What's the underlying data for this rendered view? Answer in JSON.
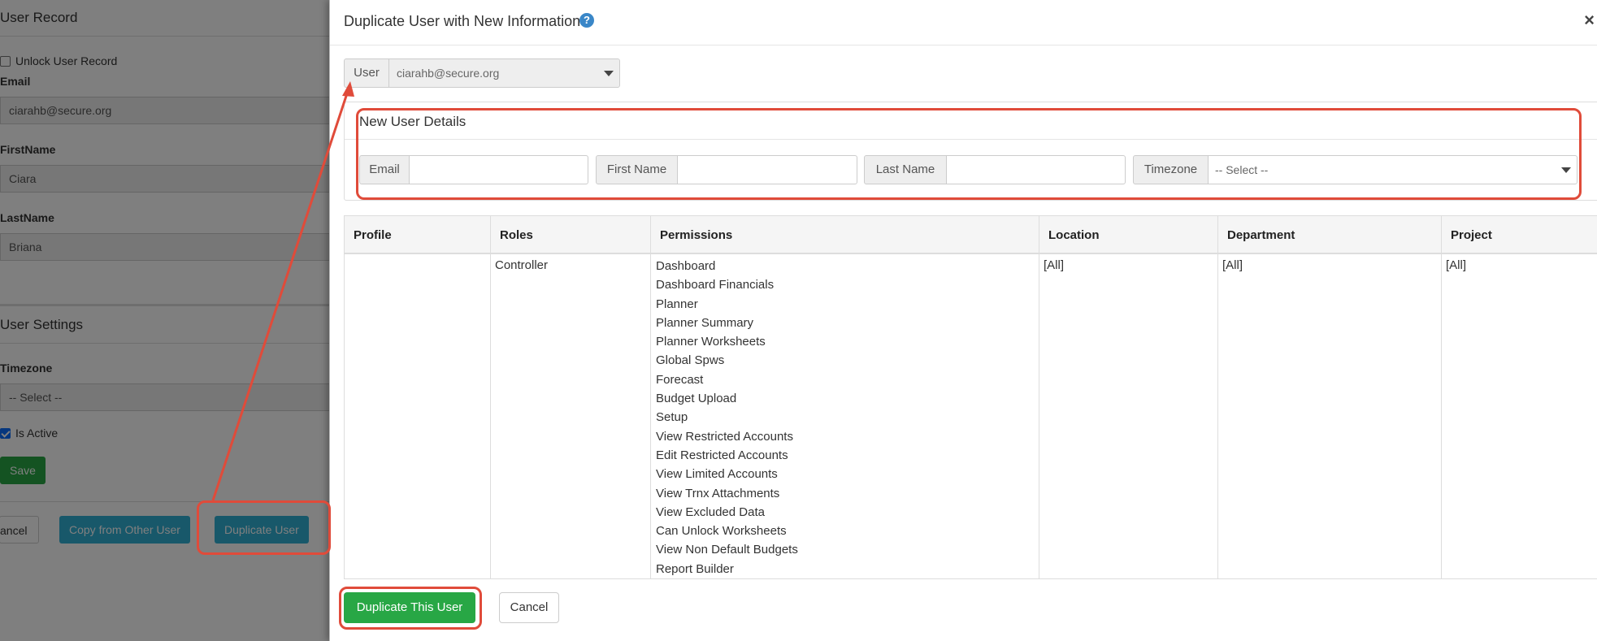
{
  "background": {
    "user_record_title": "User Record",
    "unlock_label": "Unlock User Record",
    "email_label": "Email",
    "email_value": "ciarahb@secure.org",
    "firstname_label": "FirstName",
    "firstname_value": "Ciara",
    "lastname_label": "LastName",
    "lastname_value": "Briana",
    "user_settings_title": "User Settings",
    "timezone_label": "Timezone",
    "timezone_value": "-- Select --",
    "is_active_label": "Is Active",
    "save_label": "Save",
    "cancel_label": "ancel",
    "copy_label": "Copy from Other User",
    "duplicate_label": "Duplicate User"
  },
  "modal": {
    "title": "Duplicate User with New Information",
    "help_glyph": "?",
    "close_glyph": "×",
    "user_label": "User",
    "user_value": "ciarahb@secure.org",
    "panel_title": "New User Details",
    "fields": {
      "email_label": "Email",
      "firstname_label": "First Name",
      "lastname_label": "Last Name",
      "timezone_label": "Timezone",
      "timezone_value": "-- Select --"
    },
    "table": {
      "headers": [
        "Profile",
        "Roles",
        "Permissions",
        "Location",
        "Department",
        "Project"
      ],
      "row": {
        "profile": "",
        "role": "Controller",
        "permissions": [
          "Dashboard",
          "Dashboard Financials",
          "Planner",
          "Planner Summary",
          "Planner Worksheets",
          "Global Spws",
          "Forecast",
          "Budget Upload",
          "Setup",
          "View Restricted Accounts",
          "Edit Restricted Accounts",
          "View Limited Accounts",
          "View Trnx Attachments",
          "View Excluded Data",
          "Can Unlock Worksheets",
          "View Non Default Budgets",
          "Report Builder"
        ],
        "location": "[All]",
        "department": "[All]",
        "project": "[All]"
      }
    },
    "duplicate_button": "Duplicate This User",
    "cancel_button": "Cancel"
  },
  "colors": {
    "accent_green": "#28a745",
    "info_blue": "#3a87c8",
    "annotation_red": "#e04b3a"
  }
}
